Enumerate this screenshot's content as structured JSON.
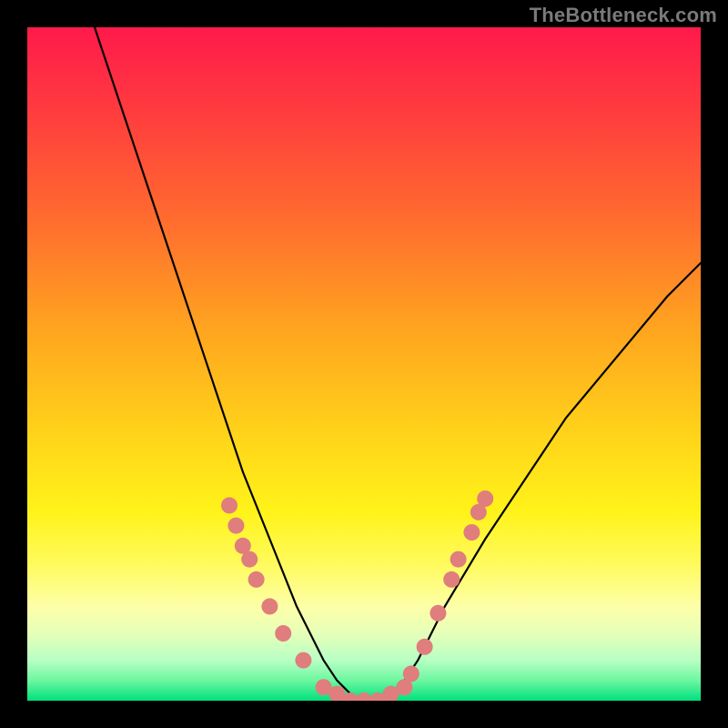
{
  "watermark": "TheBottleneck.com",
  "colors": {
    "background": "#000000",
    "dot": "#e07d7d",
    "curve": "#000000",
    "gradient_top": "#ff1a4b",
    "gradient_bottom": "#00e07e"
  },
  "chart_data": {
    "type": "line",
    "title": "",
    "xlabel": "",
    "ylabel": "",
    "xlim": [
      0,
      100
    ],
    "ylim": [
      0,
      100
    ],
    "x": [
      10,
      12,
      14,
      16,
      18,
      20,
      22,
      24,
      26,
      28,
      30,
      32,
      34,
      36,
      38,
      40,
      42,
      44,
      46,
      48,
      50,
      52,
      54,
      56,
      58,
      60,
      62,
      65,
      68,
      72,
      76,
      80,
      85,
      90,
      95,
      100
    ],
    "y": [
      100,
      94,
      88,
      82,
      76,
      70,
      64,
      58,
      52,
      46,
      40,
      34,
      29,
      24,
      19,
      14,
      10,
      6,
      3,
      1,
      0,
      0,
      1,
      3,
      6,
      10,
      14,
      19,
      24,
      30,
      36,
      42,
      48,
      54,
      60,
      65
    ],
    "annotations": {
      "note": "V-shaped curve over vertical red-to-green gradient; salmon dots cluster on lower sides of V",
      "dot_points": [
        {
          "x": 30,
          "y": 29
        },
        {
          "x": 31,
          "y": 26
        },
        {
          "x": 32,
          "y": 23
        },
        {
          "x": 33,
          "y": 21
        },
        {
          "x": 34,
          "y": 18
        },
        {
          "x": 36,
          "y": 14
        },
        {
          "x": 38,
          "y": 10
        },
        {
          "x": 41,
          "y": 6
        },
        {
          "x": 44,
          "y": 2
        },
        {
          "x": 46,
          "y": 1
        },
        {
          "x": 48,
          "y": 0
        },
        {
          "x": 50,
          "y": 0
        },
        {
          "x": 52,
          "y": 0
        },
        {
          "x": 54,
          "y": 1
        },
        {
          "x": 56,
          "y": 2
        },
        {
          "x": 57,
          "y": 4
        },
        {
          "x": 59,
          "y": 8
        },
        {
          "x": 61,
          "y": 13
        },
        {
          "x": 63,
          "y": 18
        },
        {
          "x": 64,
          "y": 21
        },
        {
          "x": 66,
          "y": 25
        },
        {
          "x": 67,
          "y": 28
        },
        {
          "x": 68,
          "y": 30
        }
      ]
    }
  }
}
